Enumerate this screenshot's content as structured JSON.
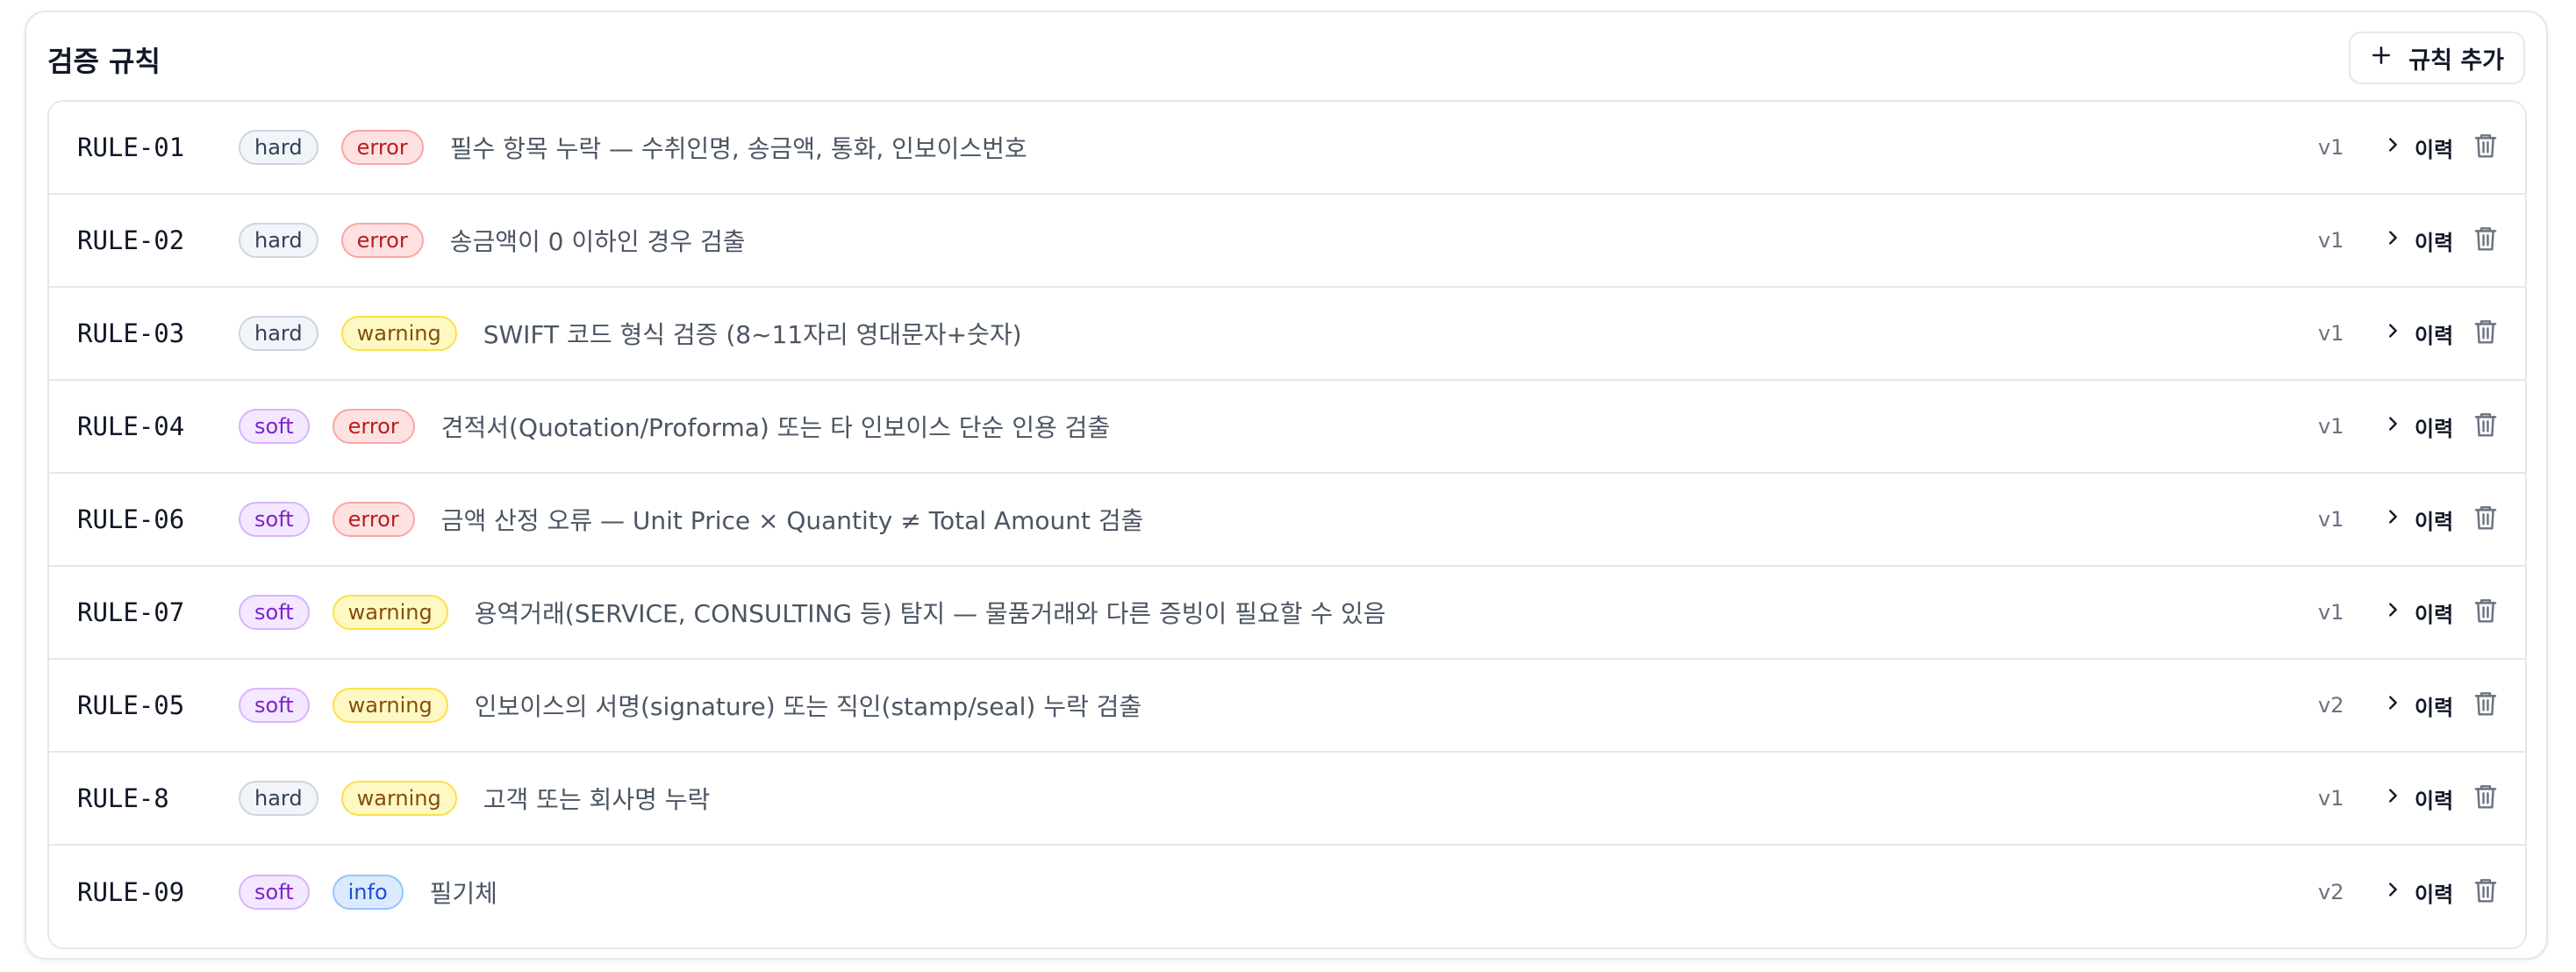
{
  "panel": {
    "title": "검증 규칙",
    "add_button_label": "규칙 추가"
  },
  "colors": {
    "hard": "#334155",
    "soft": "#7e22ce",
    "error": "#b91c1c",
    "warning": "#854d0e",
    "info": "#1d4ed8"
  },
  "rules": [
    {
      "id": "RULE-01",
      "type": "hard",
      "severity": "error",
      "description": "필수 항목 누락 — 수취인명, 송금액, 통화, 인보이스번호",
      "version": "v1",
      "history_label": "이력"
    },
    {
      "id": "RULE-02",
      "type": "hard",
      "severity": "error",
      "description": "송금액이 0 이하인 경우 검출",
      "version": "v1",
      "history_label": "이력"
    },
    {
      "id": "RULE-03",
      "type": "hard",
      "severity": "warning",
      "description": "SWIFT 코드 형식 검증 (8~11자리 영대문자+숫자)",
      "version": "v1",
      "history_label": "이력"
    },
    {
      "id": "RULE-04",
      "type": "soft",
      "severity": "error",
      "description": "견적서(Quotation/Proforma) 또는 타 인보이스 단순 인용 검출",
      "version": "v1",
      "history_label": "이력"
    },
    {
      "id": "RULE-06",
      "type": "soft",
      "severity": "error",
      "description": "금액 산정 오류 — Unit Price × Quantity ≠ Total Amount 검출",
      "version": "v1",
      "history_label": "이력"
    },
    {
      "id": "RULE-07",
      "type": "soft",
      "severity": "warning",
      "description": "용역거래(SERVICE, CONSULTING 등) 탐지 — 물품거래와 다른 증빙이 필요할 수 있음",
      "version": "v1",
      "history_label": "이력"
    },
    {
      "id": "RULE-05",
      "type": "soft",
      "severity": "warning",
      "description": "인보이스의 서명(signature) 또는 직인(stamp/seal) 누락 검출",
      "version": "v2",
      "history_label": "이력"
    },
    {
      "id": "RULE-8",
      "type": "hard",
      "severity": "warning",
      "description": "고객 또는 회사명 누락",
      "version": "v1",
      "history_label": "이력"
    },
    {
      "id": "RULE-09",
      "type": "soft",
      "severity": "info",
      "description": "필기체",
      "version": "v2",
      "history_label": "이력"
    }
  ],
  "icons": {
    "add": "plus-icon",
    "history": "chevron-right-icon",
    "delete": "trash-icon"
  }
}
